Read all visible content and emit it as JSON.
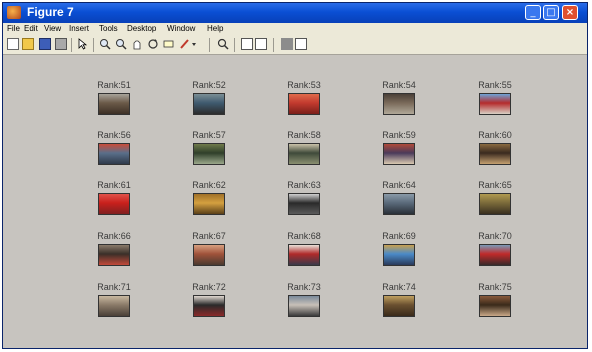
{
  "window": {
    "title": "Figure 7"
  },
  "menu": [
    "File",
    "Edit",
    "View",
    "Insert",
    "Tools",
    "Desktop",
    "Window",
    "Help"
  ],
  "toolbar_icons": [
    "new-figure-icon",
    "open-icon",
    "save-icon",
    "print-icon",
    "pointer-icon",
    "zoom-in-icon",
    "zoom-out-icon",
    "pan-icon",
    "rotate-icon",
    "data-cursor-icon",
    "brush-icon",
    "link-icon",
    "colorbar-icon",
    "legend-icon",
    "hide-plot-tools-icon",
    "show-plot-tools-icon"
  ],
  "grid": {
    "rows": [
      [
        {
          "label": "Rank:51",
          "colors": [
            "#6b5a48",
            "#a7a39a",
            "#3d3026"
          ]
        },
        {
          "label": "Rank:52",
          "colors": [
            "#3f5a6f",
            "#7a8e95",
            "#2c2c2c"
          ]
        },
        {
          "label": "Rank:53",
          "colors": [
            "#c23a2e",
            "#e06a4a",
            "#7a1f1a"
          ]
        },
        {
          "label": "Rank:54",
          "colors": [
            "#7a6a5a",
            "#4a4038",
            "#b0a898"
          ]
        },
        {
          "label": "Rank:55",
          "colors": [
            "#b52b2b",
            "#6ea3d6",
            "#d8d0c4"
          ]
        }
      ],
      [
        {
          "label": "Rank:56",
          "colors": [
            "#5a6f8a",
            "#c94d3a",
            "#2f3a4a"
          ]
        },
        {
          "label": "Rank:57",
          "colors": [
            "#2f3f2a",
            "#6f7a4a",
            "#9aa78a"
          ]
        },
        {
          "label": "Rank:58",
          "colors": [
            "#3f4a3a",
            "#c9c2a8",
            "#8a8f70"
          ]
        },
        {
          "label": "Rank:59",
          "colors": [
            "#4a3a5a",
            "#b04a3a",
            "#d8c8b0"
          ]
        },
        {
          "label": "Rank:60",
          "colors": [
            "#3a2a1f",
            "#8a6a40",
            "#c4a070"
          ]
        }
      ],
      [
        {
          "label": "Rank:61",
          "colors": [
            "#c8201c",
            "#e0524a",
            "#802020"
          ]
        },
        {
          "label": "Rank:62",
          "colors": [
            "#d4a040",
            "#a07028",
            "#5a4018"
          ]
        },
        {
          "label": "Rank:63",
          "colors": [
            "#2a2a2a",
            "#d0d0d0",
            "#5a5a5a"
          ]
        },
        {
          "label": "Rank:64",
          "colors": [
            "#5a6a7a",
            "#8a9aa8",
            "#2a3038"
          ]
        },
        {
          "label": "Rank:65",
          "colors": [
            "#7a6a3a",
            "#b09a50",
            "#3a3020"
          ]
        }
      ],
      [
        {
          "label": "Rank:66",
          "colors": [
            "#3a2f28",
            "#8a7a6a",
            "#c24a3a"
          ]
        },
        {
          "label": "Rank:67",
          "colors": [
            "#a0523a",
            "#d8a080",
            "#4a3a30"
          ]
        },
        {
          "label": "Rank:68",
          "colors": [
            "#b02a2a",
            "#e8e0d8",
            "#3a3a4a"
          ]
        },
        {
          "label": "Rank:69",
          "colors": [
            "#4a8ac8",
            "#c8a050",
            "#2a3a5a"
          ]
        },
        {
          "label": "Rank:70",
          "colors": [
            "#c02a2a",
            "#7a9ab8",
            "#3a2a2a"
          ]
        }
      ],
      [
        {
          "label": "Rank:71",
          "colors": [
            "#8a7a68",
            "#c8b8a0",
            "#4a4038"
          ]
        },
        {
          "label": "Rank:72",
          "colors": [
            "#2a2a2a",
            "#e0d8d0",
            "#8a2a2a"
          ]
        },
        {
          "label": "Rank:73",
          "colors": [
            "#c8c0b8",
            "#7a8a9a",
            "#3a3a3a"
          ]
        },
        {
          "label": "Rank:74",
          "colors": [
            "#6a5030",
            "#c0a060",
            "#3a2a1a"
          ]
        },
        {
          "label": "Rank:75",
          "colors": [
            "#3a2a1a",
            "#8a5a3a",
            "#c8a888"
          ]
        }
      ]
    ]
  }
}
